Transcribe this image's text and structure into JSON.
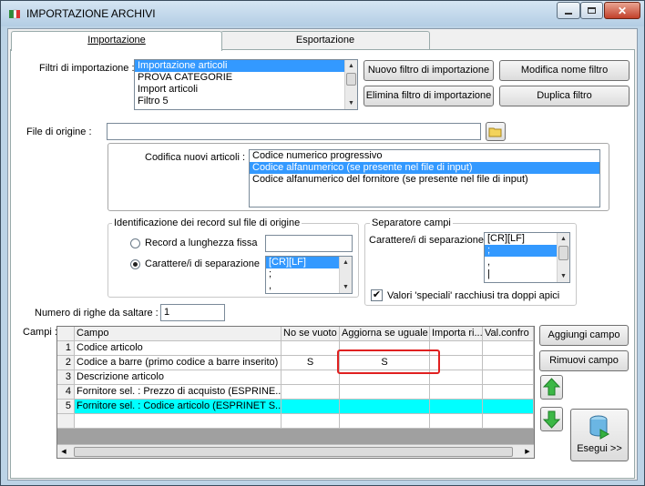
{
  "window": {
    "title": "IMPORTAZIONE ARCHIVI"
  },
  "tabs": [
    {
      "label": "Importazione",
      "active": true
    },
    {
      "label": "Esportazione",
      "active": false
    }
  ],
  "filters": {
    "label": "Filtri di importazione :",
    "items": [
      "Importazione articoli",
      "PROVA CATEGORIE",
      "Import articoli",
      "Filtro 5"
    ],
    "selected_index": 0,
    "new_button": "Nuovo filtro di importazione",
    "delete_button": "Elimina filtro di importazione",
    "rename_button": "Modifica nome filtro",
    "duplicate_button": "Duplica filtro"
  },
  "source_file": {
    "label": "File di origine :",
    "value": ""
  },
  "codifica": {
    "label": "Codifica nuovi articoli :",
    "items": [
      "Codice numerico progressivo",
      "Codice alfanumerico (se presente nel file di input)",
      "Codice alfanumerico del fornitore (se presente nel file di input)"
    ],
    "selected_index": 1
  },
  "identificazione": {
    "title": "Identificazione dei record sul file di origine",
    "fixed_label": "Record a lunghezza fissa",
    "sep_label": "Carattere/i di separazione",
    "sep_items": [
      "[CR][LF]",
      ";",
      ","
    ],
    "fixed_value": ""
  },
  "separatore": {
    "title": "Separatore campi",
    "label": "Carattere/i di separazione",
    "items": [
      "[CR][LF]",
      ";",
      ",",
      "|"
    ],
    "checkbox_label": "Valori 'speciali' racchiusi tra doppi apici",
    "checked": true
  },
  "skip_rows": {
    "label": "Numero di righe da saltare :",
    "value": "1"
  },
  "campi": {
    "label": "Campi :",
    "columns": [
      "Campo",
      "No se vuoto",
      "Aggiorna se uguale",
      "Importa ri...",
      "Val.confro"
    ],
    "rows": [
      {
        "num": "1",
        "campo": "Codice articolo",
        "no_se_vuoto": "",
        "aggiorna": ""
      },
      {
        "num": "2",
        "campo": "Codice a barre (primo codice a barre inserito)",
        "no_se_vuoto": "S",
        "aggiorna": "S"
      },
      {
        "num": "3",
        "campo": "Descrizione articolo",
        "no_se_vuoto": "",
        "aggiorna": ""
      },
      {
        "num": "4",
        "campo": "Fornitore sel. : Prezzo di acquisto (ESPRINE...",
        "no_se_vuoto": "",
        "aggiorna": ""
      },
      {
        "num": "5",
        "campo": "Fornitore sel. : Codice articolo (ESPRINET S...",
        "no_se_vuoto": "",
        "aggiorna": ""
      }
    ],
    "add_button": "Aggiungi campo",
    "remove_button": "Rimuovi campo",
    "run_button": "Esegui >>"
  },
  "colors": {
    "selection": "#3399ff",
    "highlight_row": "#00ffff",
    "annotation": "#e02020"
  }
}
